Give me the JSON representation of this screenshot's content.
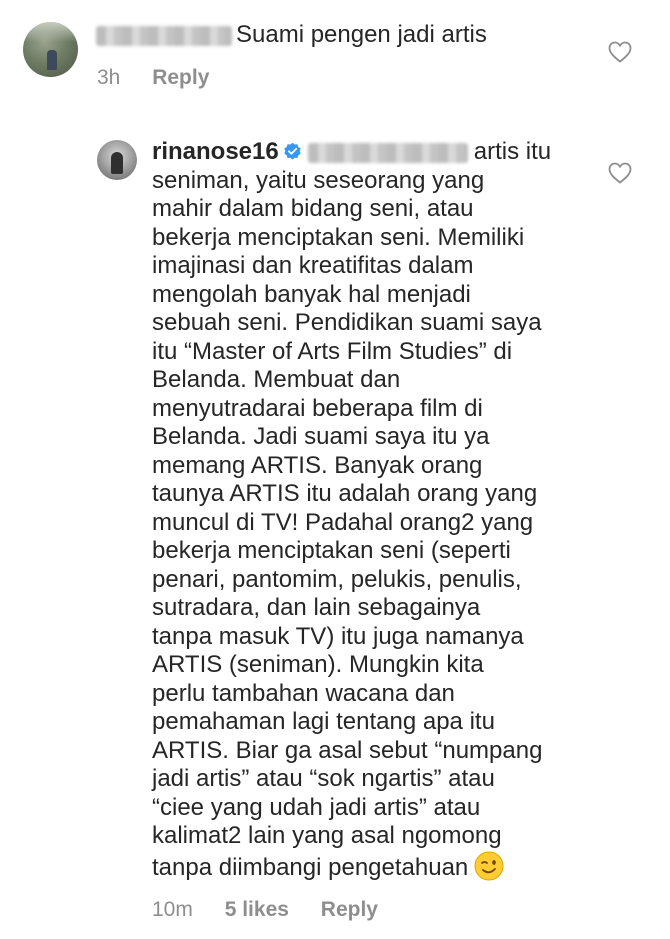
{
  "comment_1": {
    "text": "Suami pengen jadi artis",
    "time": "3h",
    "reply_label": "Reply"
  },
  "comment_2": {
    "username": "rinanose16",
    "lines": [
      "artis itu",
      "seniman, yaitu seseorang yang",
      "mahir dalam bidang seni, atau",
      "bekerja menciptakan seni. Memiliki",
      "imajinasi dan kreatifitas dalam",
      "mengolah banyak hal menjadi",
      "sebuah seni. Pendidikan suami saya",
      "itu “Master of Arts Film Studies” di",
      "Belanda. Membuat dan",
      "menyutradarai beberapa film di",
      "Belanda. Jadi suami saya itu ya",
      "memang ARTIS. Banyak orang",
      "taunya ARTIS itu adalah orang yang",
      "muncul di TV! Padahal orang2 yang",
      "bekerja menciptakan seni (seperti",
      "penari, pantomim, pelukis, penulis,",
      "sutradara, dan lain sebagainya",
      "tanpa masuk TV) itu juga namanya",
      "ARTIS (seniman). Mungkin kita",
      "perlu tambahan wacana dan",
      "pemahaman lagi tentang apa itu",
      "ARTIS. Biar ga asal sebut “numpang",
      "jadi artis” atau “sok ngartis” atau",
      "“ciee yang udah jadi artis” atau",
      "kalimat2 lain yang asal ngomong",
      "tanpa diimbangi pengetahuan"
    ],
    "time": "10m",
    "likes": "5 likes",
    "reply_label": "Reply"
  },
  "icons": {
    "heart": "heart-outline-icon",
    "verified": "verified-badge-icon",
    "emoji": "winking-face-emoji"
  },
  "colors": {
    "text": "#262626",
    "meta": "#8e8e8e",
    "verified": "#3897f0"
  }
}
